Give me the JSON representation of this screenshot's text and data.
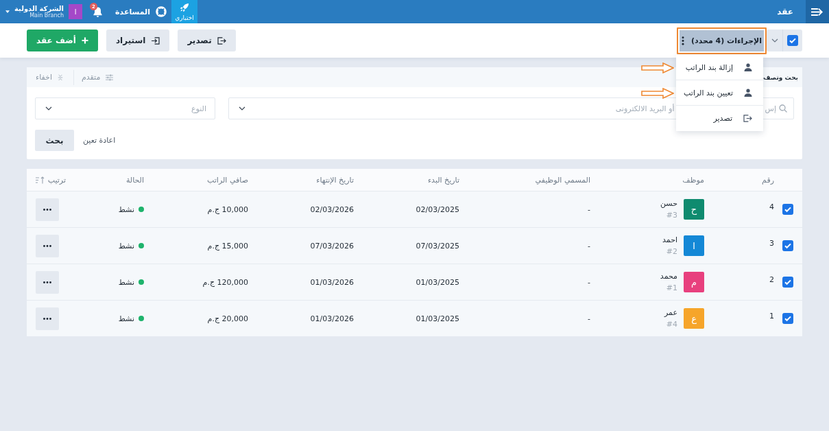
{
  "top_bar": {
    "page_title": "عقد",
    "trial": {
      "label": "اختباري"
    },
    "help": {
      "label": "المساعدة"
    },
    "notifications": {
      "count": "2"
    },
    "company": {
      "initial": "ا",
      "name": "الشركة الدولية",
      "branch": "Main Branch"
    }
  },
  "toolbar": {
    "select_all": {
      "checked": true
    },
    "actions": {
      "label": "الإجراءات (4 محدد)",
      "highlighted": true
    },
    "buttons": [
      {
        "kind": "export",
        "label": "تصدير"
      },
      {
        "kind": "import",
        "label": "استيراد"
      },
      {
        "kind": "add",
        "label": "أضف عقد"
      }
    ]
  },
  "actions_menu": {
    "items": [
      {
        "kind": "person",
        "label": "إزالة بند الراتب",
        "pointed_at": true
      },
      {
        "kind": "person",
        "label": "تعيين بند الراتب",
        "pointed_at": true
      },
      {
        "kind": "export",
        "label": "تصدير",
        "pointed_at": false
      }
    ]
  },
  "filter": {
    "title": "بحث وتصف",
    "advanced": "متقدم",
    "hide": "اخفاء",
    "search": {
      "placeholder": [
        "إس",
        "أو البريد الالكترونى"
      ]
    },
    "type": {
      "placeholder": "النوع"
    },
    "reset": "اعادة تعين",
    "submit": "بحث"
  },
  "table": {
    "columns": [
      {
        "kind": "number",
        "label": "رقم"
      },
      {
        "kind": "text",
        "label": "موظف"
      },
      {
        "kind": "text",
        "label": "المسمي الوظيفي"
      },
      {
        "kind": "text",
        "label": "تاريخ البدء"
      },
      {
        "kind": "text",
        "label": "تاريخ الإنتهاء"
      },
      {
        "kind": "text",
        "label": "صافي الراتب"
      },
      {
        "kind": "text",
        "label": "الحالة"
      },
      {
        "kind": "sort",
        "label": "ترتيب"
      }
    ],
    "rows": [
      {
        "selected": true,
        "number": "4",
        "employee": {
          "initial": "ح",
          "color": "#0f8b6f",
          "name": "حسن",
          "code": "#3"
        },
        "job_title": "-",
        "start_date": "02/03/2025",
        "end_date": "02/03/2026",
        "net_salary": "10,000 ج.م",
        "status": {
          "label": "نشط",
          "color": "#1eb36c"
        }
      },
      {
        "selected": true,
        "number": "3",
        "employee": {
          "initial": "ا",
          "color": "#1488d6",
          "name": "احمد",
          "code": "#2"
        },
        "job_title": "-",
        "start_date": "07/03/2025",
        "end_date": "07/03/2026",
        "net_salary": "15,000 ج.م",
        "status": {
          "label": "نشط",
          "color": "#1eb36c"
        }
      },
      {
        "selected": true,
        "number": "2",
        "employee": {
          "initial": "م",
          "color": "#e8407e",
          "name": "محمد",
          "code": "#1"
        },
        "job_title": "-",
        "start_date": "01/03/2025",
        "end_date": "01/03/2026",
        "net_salary": "120,000 ج.م",
        "status": {
          "label": "نشط",
          "color": "#1eb36c"
        }
      },
      {
        "selected": true,
        "number": "1",
        "employee": {
          "initial": "ع",
          "color": "#f6a52a",
          "name": "عمر",
          "code": "#4"
        },
        "job_title": "-",
        "start_date": "01/03/2025",
        "end_date": "01/03/2026",
        "net_salary": "20,000 ج.م",
        "status": {
          "label": "نشط",
          "color": "#1eb36c"
        }
      }
    ]
  }
}
